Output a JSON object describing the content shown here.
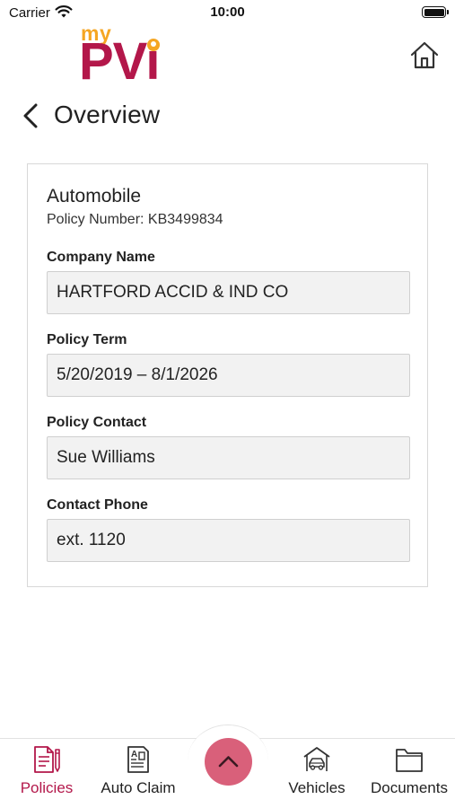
{
  "status_bar": {
    "carrier": "Carrier",
    "time": "10:00"
  },
  "logo": {
    "my": "my",
    "brand": "PVi",
    "brand_color": "#b3174a",
    "accent_color": "#f5a623"
  },
  "header": {
    "home_icon": "home-icon",
    "back_icon": "chevron-left-icon",
    "title": "Overview"
  },
  "policy": {
    "type": "Automobile",
    "number_text": "Policy Number: KB3499834",
    "fields": [
      {
        "label": "Company Name",
        "value": "HARTFORD ACCID & IND CO"
      },
      {
        "label": "Policy Term",
        "value": "5/20/2019 – 8/1/2026"
      },
      {
        "label": "Policy Contact",
        "value": "Sue Williams"
      },
      {
        "label": "Contact Phone",
        "value": "ext. 1120"
      }
    ]
  },
  "bottom_nav": {
    "items": [
      {
        "label": "Policies",
        "icon": "policy-document-icon",
        "active": true
      },
      {
        "label": "Auto Claim",
        "icon": "claim-form-icon",
        "active": false
      },
      {
        "label": "Vehicles",
        "icon": "car-garage-icon",
        "active": false
      },
      {
        "label": "Documents",
        "icon": "folder-icon",
        "active": false
      }
    ],
    "fab_icon": "chevron-up-icon",
    "active_color": "#b3174a",
    "fab_color": "#d9607a"
  }
}
